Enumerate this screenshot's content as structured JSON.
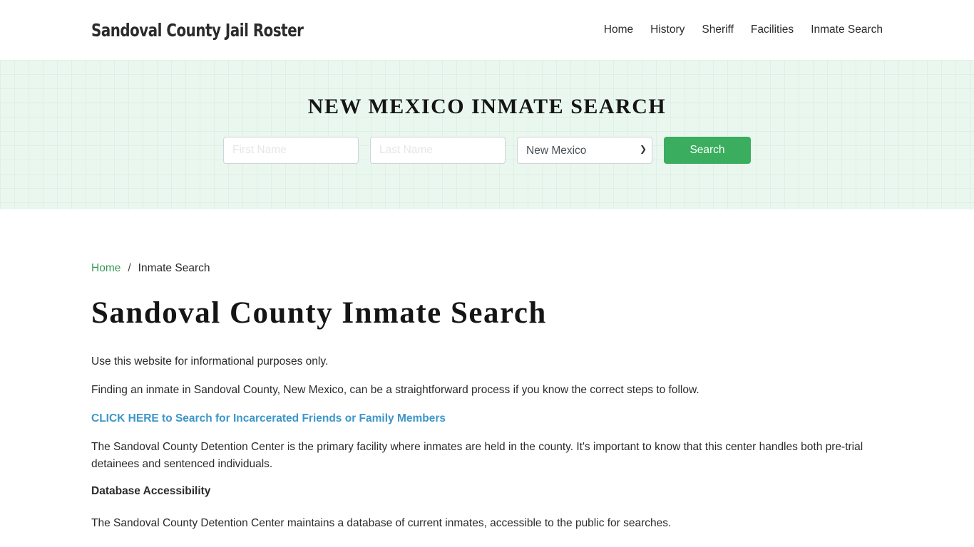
{
  "header": {
    "brand": "Sandoval County Jail Roster",
    "nav": [
      {
        "label": "Home"
      },
      {
        "label": "History"
      },
      {
        "label": "Sheriff"
      },
      {
        "label": "Facilities"
      },
      {
        "label": "Inmate Search"
      }
    ]
  },
  "hero": {
    "title": "NEW MEXICO INMATE SEARCH",
    "first_name_placeholder": "First Name",
    "last_name_placeholder": "Last Name",
    "state_selected": "New Mexico",
    "search_label": "Search"
  },
  "breadcrumb": {
    "home": "Home",
    "separator": "/",
    "current": "Inmate Search"
  },
  "main": {
    "title": "Sandoval County Inmate Search",
    "p1": "Use this website for informational purposes only.",
    "p2": "Finding an inmate in Sandoval County, New Mexico, can be a straightforward process if you know the correct steps to follow.",
    "cta": "CLICK HERE to Search for Incarcerated Friends or Family Members",
    "p3": "The Sandoval County Detention Center is the primary facility where inmates are held in the county. It's important to know that this center handles both pre-trial detainees and sentenced individuals.",
    "h_database": "Database Accessibility",
    "p4": "The Sandoval County Detention Center maintains a database of current inmates, accessible to the public for searches."
  },
  "colors": {
    "accent_green": "#3aad5e",
    "link_blue": "#3d96c9",
    "breadcrumb_green": "#3a9a5a",
    "hero_bg": "#eaf7ef"
  }
}
